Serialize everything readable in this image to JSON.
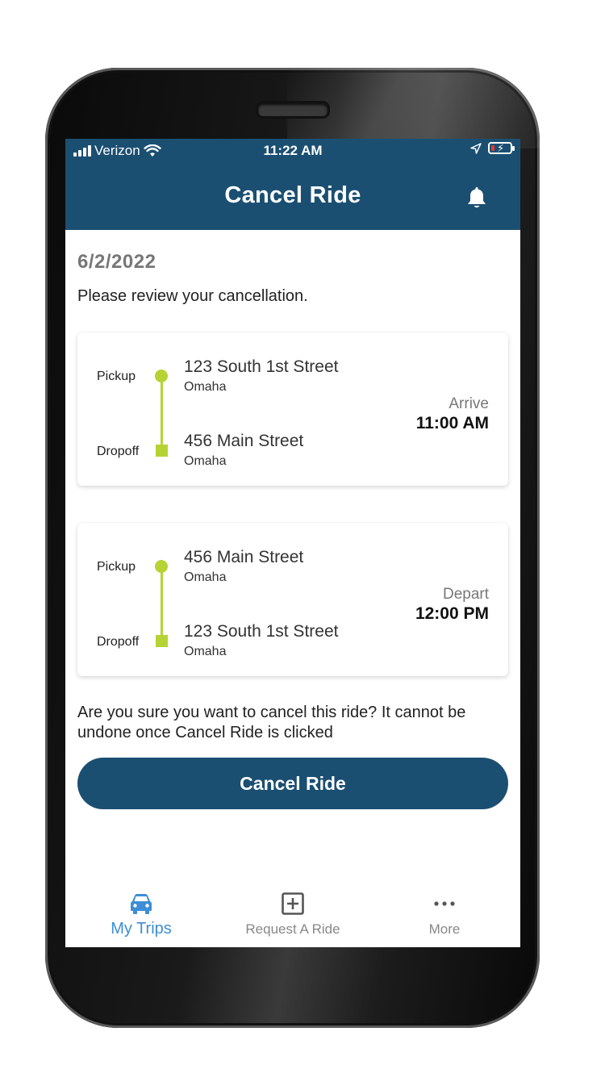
{
  "status_bar": {
    "carrier": "Verizon",
    "time": "11:22 AM"
  },
  "header": {
    "title": "Cancel Ride",
    "icon": "bell-icon"
  },
  "ride": {
    "date": "6/2/2022",
    "review_text": "Please review your cancellation.",
    "trips": [
      {
        "pickup_label": "Pickup",
        "dropoff_label": "Dropoff",
        "pickup_address": "123 South 1st Street",
        "pickup_city": "Omaha",
        "dropoff_address": "456 Main Street",
        "dropoff_city": "Omaha",
        "time_label": "Arrive",
        "time_value": "11:00 AM"
      },
      {
        "pickup_label": "Pickup",
        "dropoff_label": "Dropoff",
        "pickup_address": "456 Main Street",
        "pickup_city": "Omaha",
        "dropoff_address": "123 South 1st Street",
        "dropoff_city": "Omaha",
        "time_label": "Depart",
        "time_value": "12:00 PM"
      }
    ],
    "confirm_text": "Are you sure you want to cancel this ride? It cannot be undone once Cancel Ride is clicked",
    "cancel_button_label": "Cancel Ride"
  },
  "tabs": [
    {
      "label": "My Trips",
      "icon": "car-icon",
      "active": true
    },
    {
      "label": "Request A Ride",
      "icon": "plus-square-icon",
      "active": false
    },
    {
      "label": "More",
      "icon": "more-dots-icon",
      "active": false
    }
  ],
  "colors": {
    "header": "#1b4f72",
    "route": "#b5d334",
    "tab_active": "#3d8ed6",
    "tab_inactive": "#888888"
  }
}
